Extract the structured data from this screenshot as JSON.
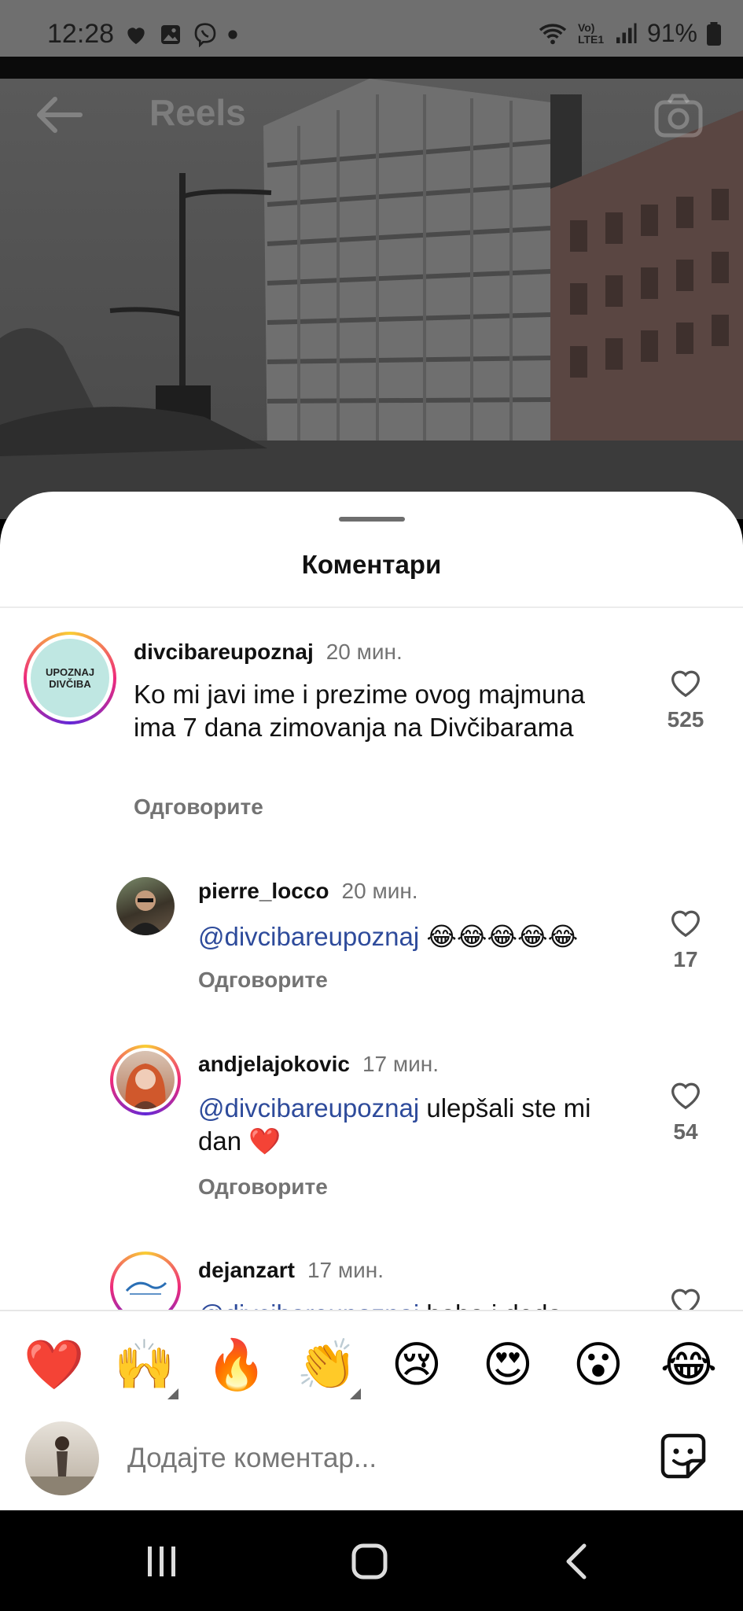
{
  "status_bar": {
    "time": "12:28",
    "battery": "91%",
    "network": "Vo) LTE1",
    "icons": [
      "heart-icon",
      "gallery-icon",
      "viber-icon",
      "dot-icon",
      "wifi-icon",
      "signal-icon",
      "battery-icon"
    ]
  },
  "header": {
    "title": "Reels"
  },
  "sheet": {
    "title": "Коментари"
  },
  "comments": [
    {
      "user": "divcibareupoznaj",
      "time": "20 мин.",
      "text": "Ko mi javi ime i prezime ovog majmuna ima 7 dana zimovanja na Divčibarama",
      "reply_label": "Одговорите",
      "likes": "525",
      "avatar_text": "UPOZNAJ DIVČIBA"
    },
    {
      "user": "pierre_locco",
      "time": "20 мин.",
      "mention": "@divcibareupoznaj",
      "text": "😂😂😂😂😂",
      "reply_label": "Одговорите",
      "likes": "17"
    },
    {
      "user": "andjelajokovic",
      "time": "17 мин.",
      "mention": "@divcibareupoznaj",
      "text": " ulepšali ste mi dan ❤️",
      "reply_label": "Одговорите",
      "likes": "54"
    },
    {
      "user": "dejanzart",
      "time": "17 мин.",
      "mention": "@divcibareupoznaj",
      "text": " baba i deda"
    }
  ],
  "emoji_bar": [
    "❤️",
    "🙌",
    "🔥",
    "👏",
    "😢",
    "😍",
    "😮",
    "😂"
  ],
  "input": {
    "placeholder": "Додајте коментар..."
  },
  "colors": {
    "mention": "#2e4b9b",
    "muted": "#737373",
    "sheet_bg": "#ffffff"
  }
}
